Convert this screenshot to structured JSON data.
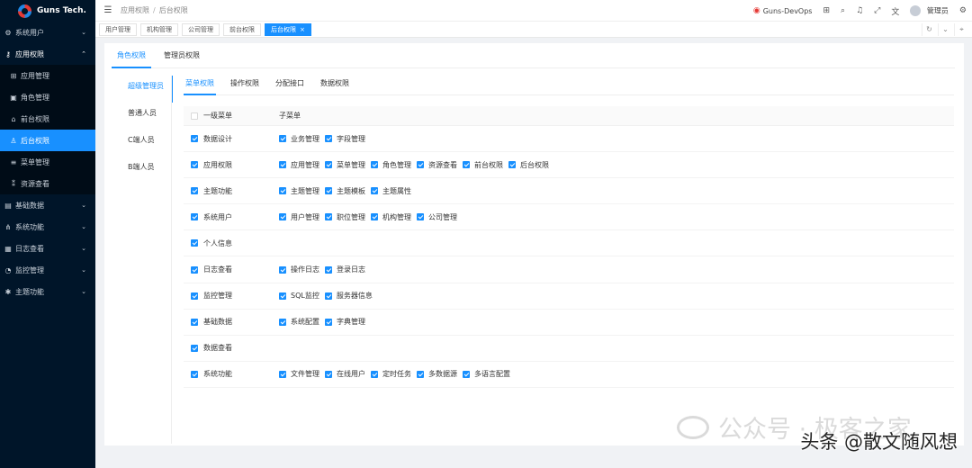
{
  "app": {
    "logo_text": "Guns Tech."
  },
  "sidebar": {
    "items": [
      {
        "icon": "gear-icon",
        "glyph": "⚙",
        "label": "系统用户",
        "open": false
      },
      {
        "icon": "shield-icon",
        "glyph": "⚷",
        "label": "应用权限",
        "open": true,
        "children": [
          {
            "icon": "grid-icon",
            "glyph": "⊞",
            "label": "应用管理",
            "active": false
          },
          {
            "icon": "image-icon",
            "glyph": "▣",
            "label": "角色管理",
            "active": false
          },
          {
            "icon": "home-icon",
            "glyph": "⌂",
            "label": "前台权限",
            "active": false
          },
          {
            "icon": "user-icon",
            "glyph": "♙",
            "label": "后台权限",
            "active": true
          },
          {
            "icon": "list-icon",
            "glyph": "≡",
            "label": "菜单管理",
            "active": false
          },
          {
            "icon": "resource-icon",
            "glyph": "⁑",
            "label": "资源查看",
            "active": false
          }
        ]
      },
      {
        "icon": "table-icon",
        "glyph": "▤",
        "label": "基础数据",
        "open": false
      },
      {
        "icon": "cluster-icon",
        "glyph": "⋔",
        "label": "系统功能",
        "open": false
      },
      {
        "icon": "calendar-icon",
        "glyph": "▦",
        "label": "日志查看",
        "open": false
      },
      {
        "icon": "monitor-icon",
        "glyph": "◔",
        "label": "监控管理",
        "open": false
      },
      {
        "icon": "theme-icon",
        "glyph": "✱",
        "label": "主题功能",
        "open": false
      }
    ]
  },
  "header": {
    "breadcrumb": [
      "应用权限",
      "后台权限"
    ],
    "env_label": "Guns-DevOps",
    "user_name": "管理员"
  },
  "tabs": [
    {
      "label": "用户管理",
      "active": false
    },
    {
      "label": "机构管理",
      "active": false
    },
    {
      "label": "公司管理",
      "active": false
    },
    {
      "label": "前台权限",
      "active": false
    },
    {
      "label": "后台权限",
      "active": true,
      "closable": true
    }
  ],
  "top_tabs": [
    {
      "label": "角色权限",
      "active": true
    },
    {
      "label": "管理员权限",
      "active": false
    }
  ],
  "roles": [
    {
      "label": "超级管理员",
      "active": true
    },
    {
      "label": "普通人员",
      "active": false
    },
    {
      "label": "C端人员",
      "active": false
    },
    {
      "label": "B端人员",
      "active": false
    }
  ],
  "sub_tabs": [
    {
      "label": "菜单权限",
      "active": true
    },
    {
      "label": "操作权限",
      "active": false
    },
    {
      "label": "分配接口",
      "active": false
    },
    {
      "label": "数据权限",
      "active": false
    }
  ],
  "table": {
    "col_main": "一级菜单",
    "col_sub": "子菜单",
    "rows": [
      {
        "label": "数据设计",
        "checked": true,
        "children": [
          "业务管理",
          "字段管理"
        ]
      },
      {
        "label": "应用权限",
        "checked": true,
        "children": [
          "应用管理",
          "菜单管理",
          "角色管理",
          "资源查看",
          "前台权限",
          "后台权限"
        ]
      },
      {
        "label": "主题功能",
        "checked": true,
        "children": [
          "主题管理",
          "主题模板",
          "主题属性"
        ]
      },
      {
        "label": "系统用户",
        "checked": true,
        "children": [
          "用户管理",
          "职位管理",
          "机构管理",
          "公司管理"
        ]
      },
      {
        "label": "个人信息",
        "checked": true,
        "children": []
      },
      {
        "label": "日志查看",
        "checked": true,
        "children": [
          "操作日志",
          "登录日志"
        ]
      },
      {
        "label": "监控管理",
        "checked": true,
        "children": [
          "SQL监控",
          "服务器信息"
        ]
      },
      {
        "label": "基础数据",
        "checked": true,
        "children": [
          "系统配置",
          "字典管理"
        ]
      },
      {
        "label": "数据查看",
        "checked": true,
        "children": []
      },
      {
        "label": "系统功能",
        "checked": true,
        "children": [
          "文件管理",
          "在线用户",
          "定时任务",
          "多数据源",
          "多语言配置"
        ]
      }
    ]
  },
  "watermark": {
    "line1": "公众号 · 极客之家",
    "line2": "头条 @散文随风想"
  },
  "colors": {
    "accent": "#1890ff",
    "sidebar_bg": "#001529",
    "submenu_bg": "#000c17"
  }
}
